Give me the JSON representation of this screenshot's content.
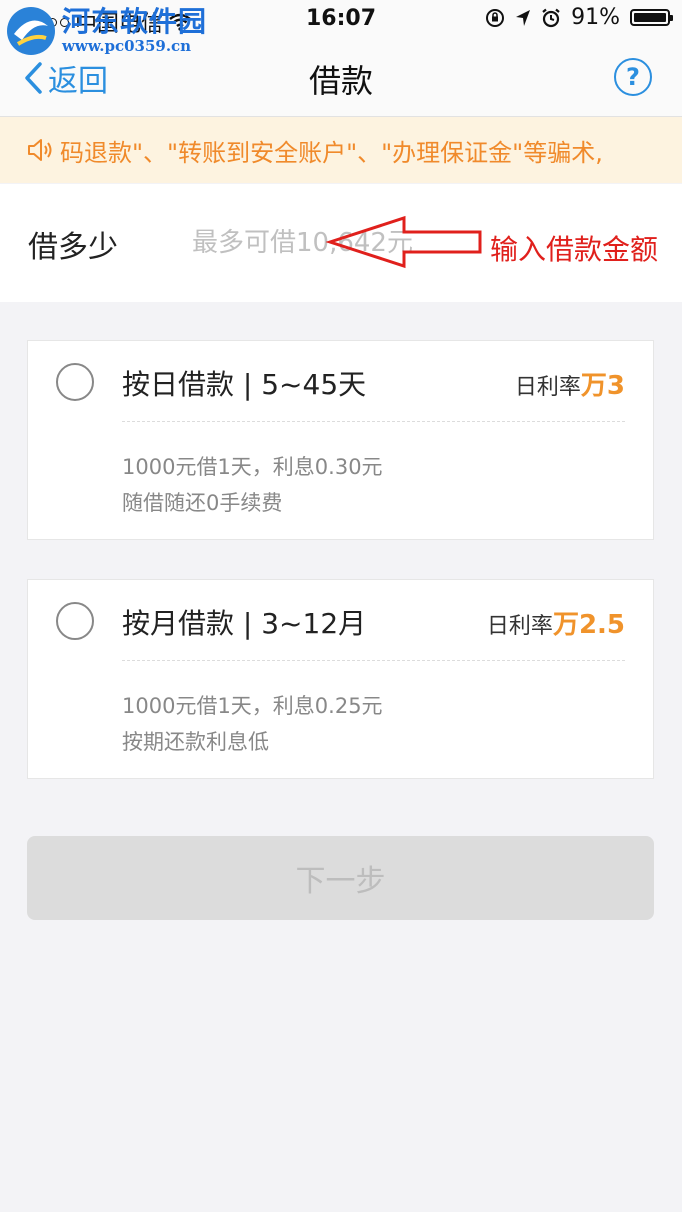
{
  "status_bar": {
    "carrier": "中国电信",
    "time": "16:07",
    "battery": "91%",
    "battery_level": 0.91,
    "signal_icon": "signal-dots-icon",
    "wifi_icon": "wifi-icon",
    "lock_icon": "rotation-lock-icon",
    "location_icon": "location-arrow-icon",
    "alarm_icon": "alarm-clock-icon"
  },
  "watermark": {
    "name": "河东软件园",
    "url": "www.pc0359.cn"
  },
  "nav": {
    "back_label": "返回",
    "title": "借款",
    "help_label": "?"
  },
  "notice": {
    "text": "码退款\"、\"转账到安全账户\"、\"办理保证金\"等骗术,",
    "icon": "speaker-icon"
  },
  "amount": {
    "label": "借多少",
    "placeholder": "最多可借10,642元",
    "annotation": "输入借款金额"
  },
  "options": [
    {
      "title": "按日借款 | 5~45天",
      "rate_label": "日利率",
      "rate_value": "万3",
      "example": "1000元借1天，利息0.30元",
      "note": "随借随还0手续费"
    },
    {
      "title": "按月借款 | 3~12月",
      "rate_label": "日利率",
      "rate_value": "万2.5",
      "example": "1000元借1天，利息0.25元",
      "note": "按期还款利息低"
    }
  ],
  "next_button": "下一步",
  "colors": {
    "accent_blue": "#2b8fdf",
    "notice_orange": "#f08a2b",
    "rate_orange": "#f0932b",
    "annotation_red": "#e0201c"
  }
}
